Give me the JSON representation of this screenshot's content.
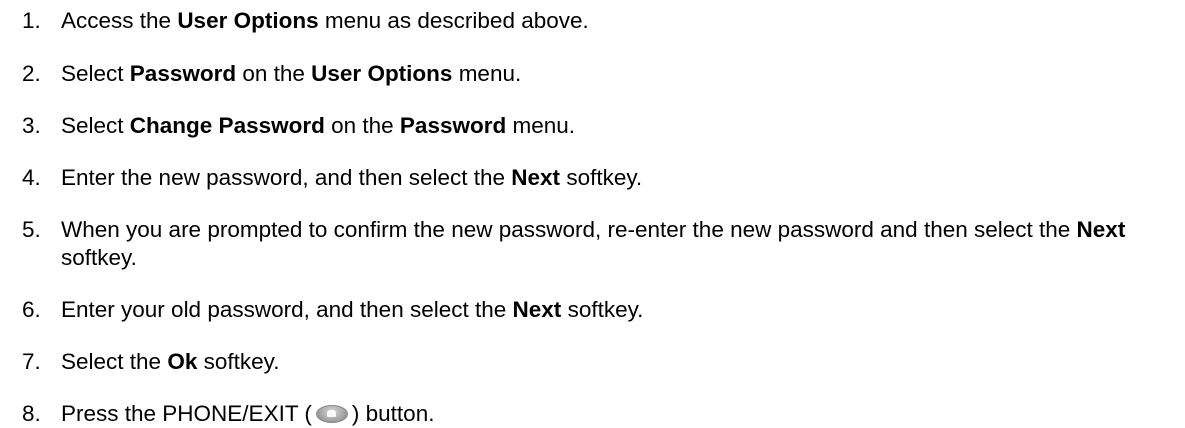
{
  "steps": [
    {
      "num": "1.",
      "parts": [
        "Access the ",
        "User Options",
        " menu as described above."
      ]
    },
    {
      "num": "2.",
      "parts": [
        "Select ",
        "Password",
        " on the ",
        "User Options",
        " menu."
      ]
    },
    {
      "num": "3.",
      "parts": [
        "Select ",
        "Change Password",
        " on the ",
        "Password",
        " menu."
      ]
    },
    {
      "num": "4.",
      "parts": [
        "Enter the new password, and then select the ",
        "Next",
        " softkey."
      ]
    },
    {
      "num": "5.",
      "parts": [
        "When you are prompted to confirm the new password, re-enter the new password and then select the ",
        "Next",
        " softkey."
      ]
    },
    {
      "num": "6.",
      "parts": [
        "Enter your old password, and then select the ",
        "Next",
        " softkey."
      ]
    },
    {
      "num": "7.",
      "parts": [
        "Select the ",
        "Ok",
        " softkey."
      ]
    },
    {
      "num": "8.",
      "parts": [
        "Press the PHONE/EXIT (",
        ") button."
      ],
      "icon": "phone-exit-button-icon"
    }
  ]
}
